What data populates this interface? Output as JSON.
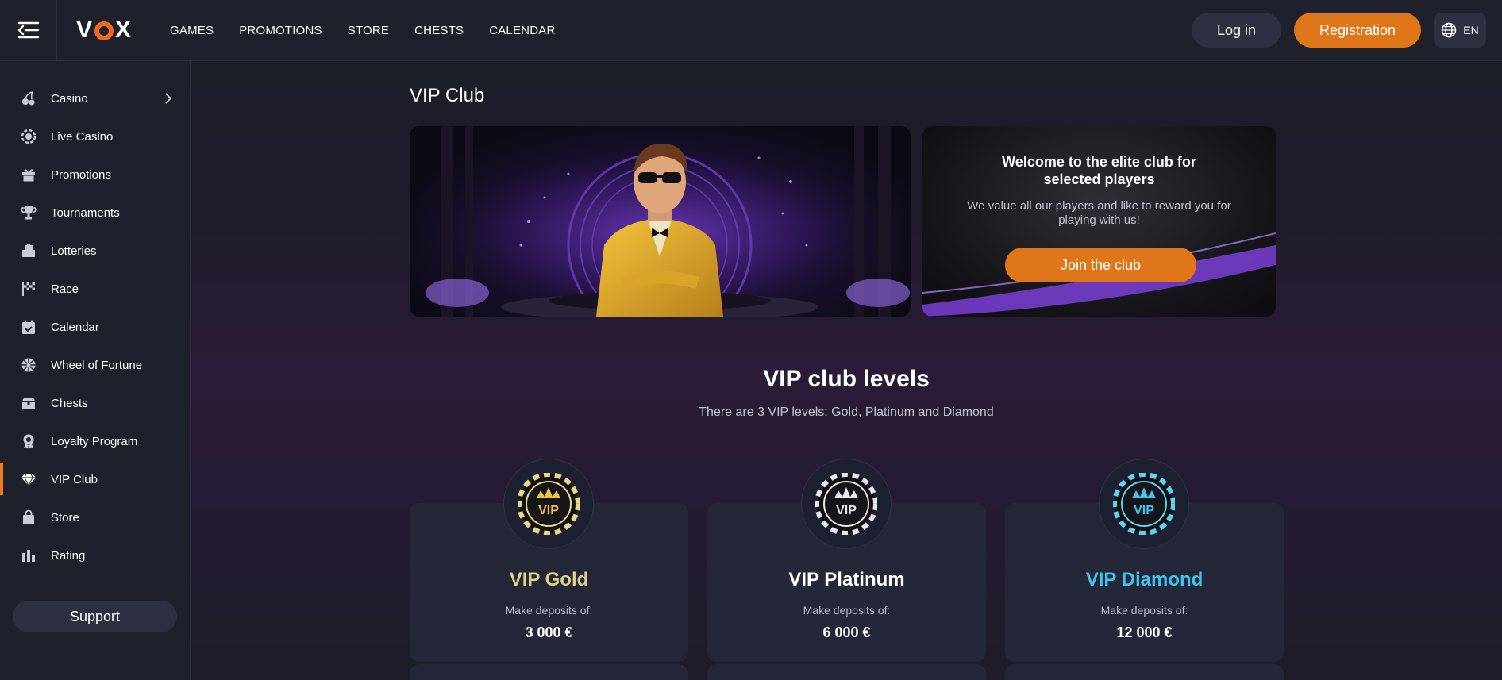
{
  "header": {
    "logo": "VOX",
    "nav": [
      "GAMES",
      "PROMOTIONS",
      "STORE",
      "CHESTS",
      "CALENDAR"
    ],
    "login_label": "Log in",
    "register_label": "Registration",
    "language": "EN"
  },
  "sidebar": {
    "items": [
      {
        "label": "Casino",
        "icon": "cherries-icon"
      },
      {
        "label": "Live Casino",
        "icon": "chip-icon"
      },
      {
        "label": "Promotions",
        "icon": "gift-icon"
      },
      {
        "label": "Tournaments",
        "icon": "trophy-icon"
      },
      {
        "label": "Lotteries",
        "icon": "ticket-icon"
      },
      {
        "label": "Race",
        "icon": "flag-icon"
      },
      {
        "label": "Calendar",
        "icon": "calendar-icon"
      },
      {
        "label": "Wheel of Fortune",
        "icon": "wheel-icon"
      },
      {
        "label": "Chests",
        "icon": "chest-icon"
      },
      {
        "label": "Loyalty Program",
        "icon": "medal-icon"
      },
      {
        "label": "VIP Club",
        "icon": "diamond-icon"
      },
      {
        "label": "Store",
        "icon": "bag-icon"
      },
      {
        "label": "Rating",
        "icon": "bars-icon"
      }
    ],
    "active": "VIP Club",
    "support_label": "Support"
  },
  "main": {
    "title": "VIP Club",
    "banner": {
      "heading": "Welcome to the elite club for selected players",
      "text": "We value all our players and like to reward you for playing with us!",
      "join_label": "Join the club"
    },
    "levels": {
      "title": "VIP club levels",
      "subtitle": "There are 3 VIP levels: Gold, Platinum and Diamond",
      "cards": [
        {
          "name": "VIP Gold",
          "label": "Make deposits of:",
          "amount": "3 000 €",
          "color": "#dcd28a"
        },
        {
          "name": "VIP Platinum",
          "label": "Make deposits of:",
          "amount": "6 000 €",
          "color": "#ffffff"
        },
        {
          "name": "VIP Diamond",
          "label": "Make deposits of:",
          "amount": "12 000 €",
          "color": "#3ec4ee"
        }
      ],
      "badge_text": "VIP"
    }
  },
  "colors": {
    "accent": "#e0761a",
    "panel": "#232737",
    "sidebar": "#1e212c"
  }
}
